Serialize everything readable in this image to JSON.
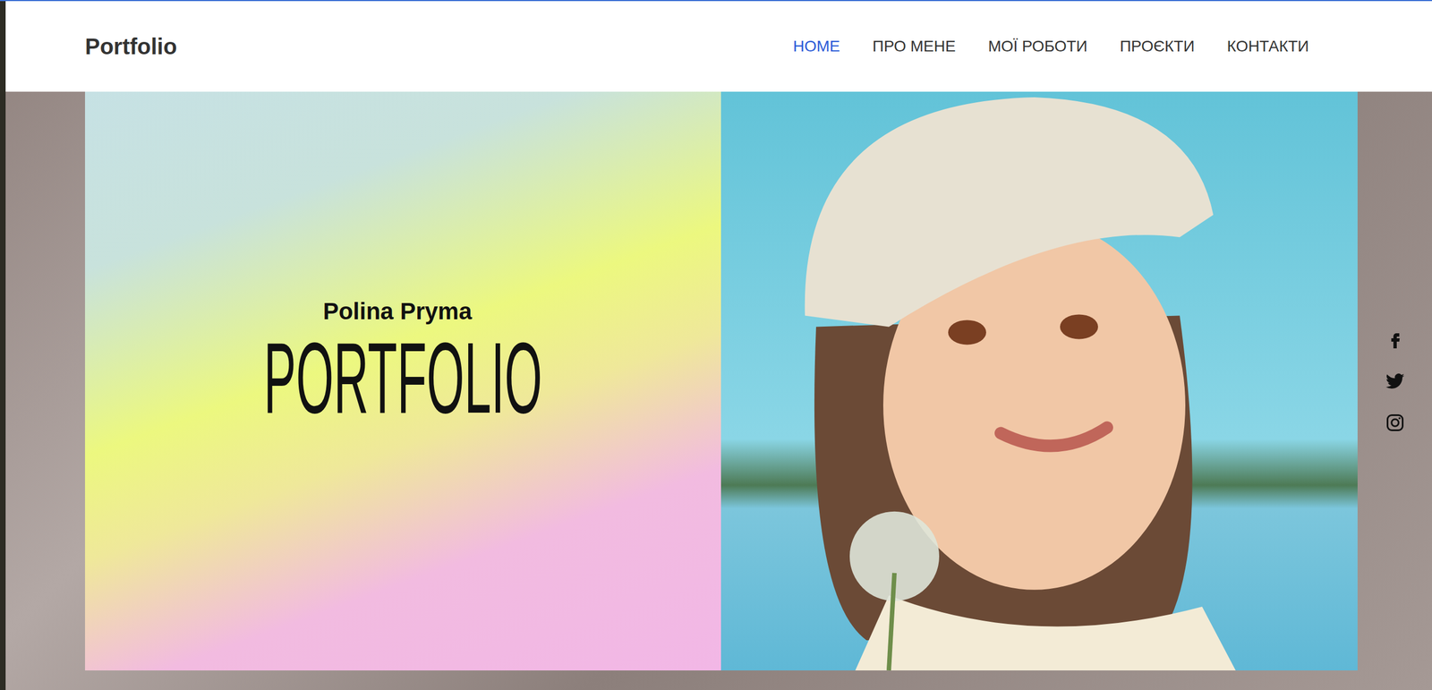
{
  "header": {
    "logo": "Portfolio"
  },
  "nav": [
    {
      "label": "HOME",
      "selected": true
    },
    {
      "label": "ПРО МЕНЕ",
      "selected": false
    },
    {
      "label": "МОЇ РОБОТИ",
      "selected": false
    },
    {
      "label": "ПРОЄКТИ",
      "selected": false
    },
    {
      "label": "КОНТАКТИ",
      "selected": false
    }
  ],
  "hero": {
    "name": "Polina Pryma",
    "title": "PORTFOLIO"
  }
}
